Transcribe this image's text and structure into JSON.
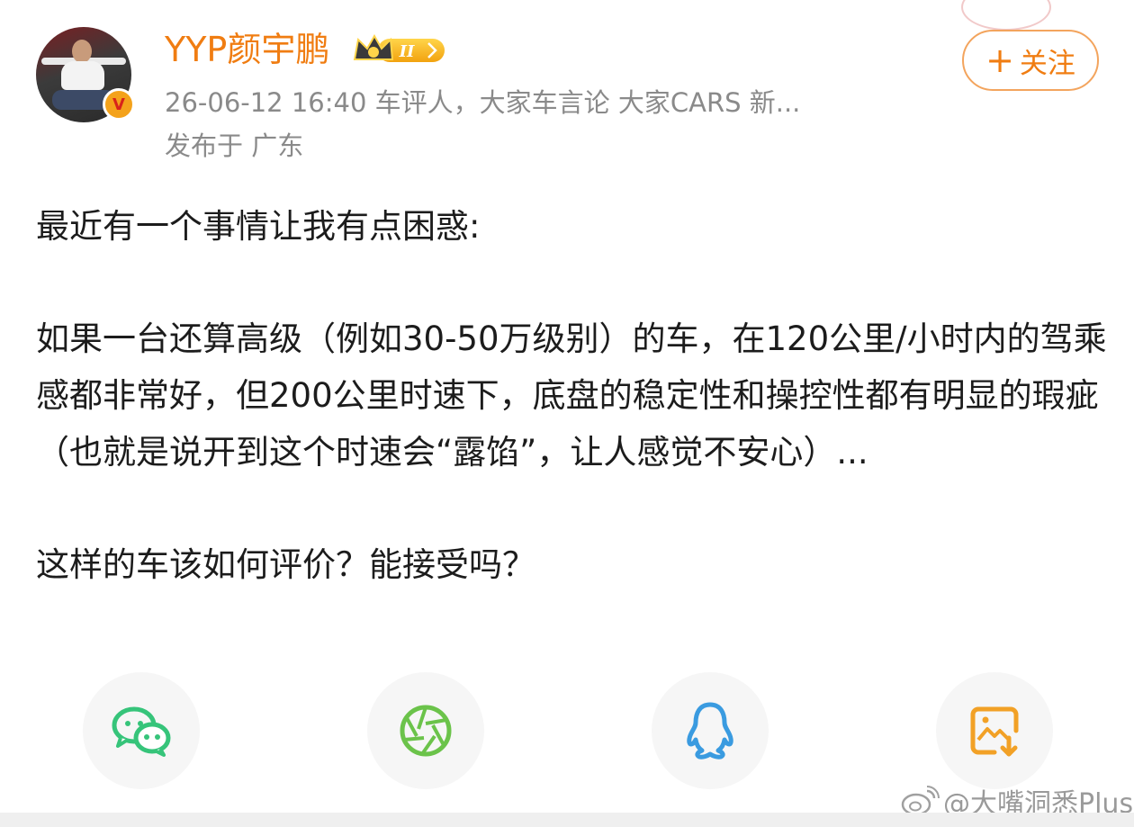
{
  "author": {
    "name": "YYP颜宇鹏",
    "level_badge": "II",
    "verified": true
  },
  "post_meta": {
    "time_source": "26-06-12 16:40  车评人，大家车言论 大家CARS 新...",
    "location": "发布于 广东"
  },
  "follow_button": {
    "label": "关注",
    "icon": "plus-icon"
  },
  "post": {
    "intro": "最近有一个事情让我有点困惑:",
    "body": "如果一台还算高级（例如30-50万级别）的车，在120公里/小时内的驾乘感都非常好，但200公里时速下，底盘的稳定性和操控性都有明显的瑕疵（也就是说开到这个时速会“露馅”，让人感觉不安心）...",
    "question": "这样的车该如何评价？能接受吗？"
  },
  "share_bar": [
    {
      "name": "wechat",
      "icon": "wechat-icon"
    },
    {
      "name": "moments",
      "icon": "moments-icon"
    },
    {
      "name": "qq",
      "icon": "qq-icon"
    },
    {
      "name": "save-image",
      "icon": "save-image-icon"
    }
  ],
  "watermark": {
    "text": "@大嘴洞悉Plus"
  },
  "colors": {
    "accent": "#f07d12",
    "meta_gray": "#8a8a8a",
    "wechat": "#36c47a",
    "moments": "#6bc34a",
    "qq": "#3a9be0",
    "save": "#f2a126"
  }
}
